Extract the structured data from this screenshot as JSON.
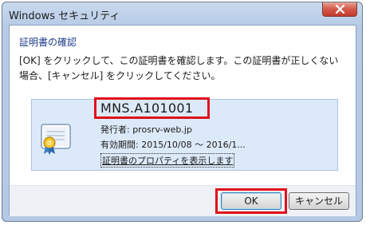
{
  "window": {
    "title": "Windows セキュリティ"
  },
  "dialog": {
    "heading": "証明書の確認",
    "message": "[OK] をクリックして、この証明書を確認します。この証明書が正しくない場合、[キャンセル] をクリックしてください。"
  },
  "certificate": {
    "name": "MNS.A101001",
    "issuer": "発行者: prosrv-web.jp",
    "validity": "有効期間: 2015/10/08 ～ 2016/1...",
    "properties_link": "証明書のプロパティを表示します"
  },
  "buttons": {
    "ok_label": "OK",
    "cancel_label": "キャンセル"
  },
  "colors": {
    "highlight": "#e0101a",
    "heading": "#1e3a8a",
    "close_button": "#c23b2c"
  },
  "icons": [
    "close-icon",
    "certificate-icon"
  ]
}
